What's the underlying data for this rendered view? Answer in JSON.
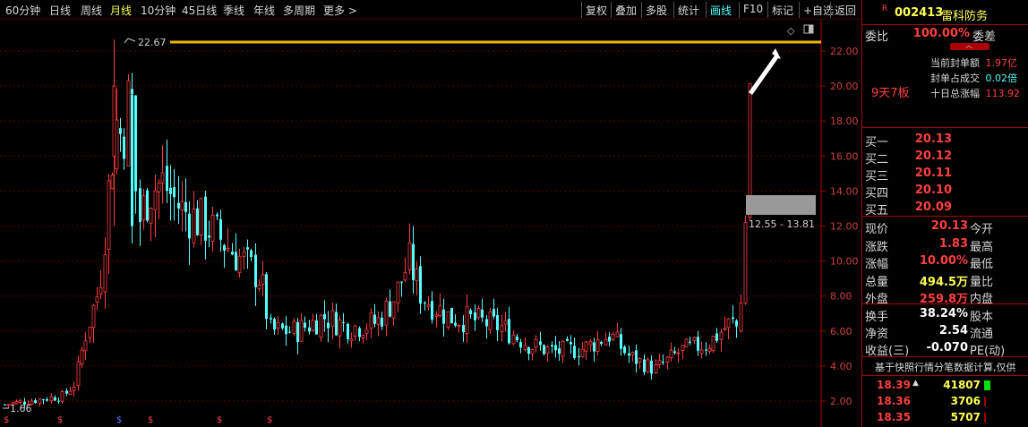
{
  "toolbar": {
    "periods": [
      "60分钟",
      "日线",
      "周线",
      "月线",
      "10分钟",
      "45日线",
      "季线",
      "年线",
      "多周期",
      "更多"
    ],
    "active_period": "月线",
    "more_arrow": ">",
    "buttons": [
      "复权",
      "叠加",
      "多股",
      "统计",
      "画线",
      "F10",
      "标记",
      "+自选",
      "返回"
    ],
    "active_button": "画线"
  },
  "chart": {
    "high_label": "22.67",
    "low_label": "1.66",
    "range_label": "12.55 - 13.81",
    "y_ticks": [
      "22.00",
      "20.00",
      "18.00",
      "16.00",
      "14.00",
      "12.00",
      "10.00",
      "8.00",
      "6.00",
      "4.00",
      "2.00"
    ],
    "colors": {
      "up": "#ff3c3c",
      "down": "#54ffff",
      "grid": "#5a0000",
      "hline": "#f0b400",
      "axis_text": "#d04040"
    },
    "markers": [
      "$",
      "$",
      "$",
      "$",
      "$",
      "$"
    ]
  },
  "panel": {
    "r_mark": "R",
    "code": "002413",
    "name": "雷科防务",
    "weibi_label": "委比",
    "weibi_value": "100.00%",
    "weicha_label": "委差",
    "seal_amount_label": "当前封单额",
    "seal_amount_value": "1.97亿",
    "seal_ratio_label": "封单占成交",
    "seal_ratio_value": "0.02倍",
    "ten_day_label": "十日总涨幅",
    "ten_day_value": "113.92",
    "streak": "9天7板",
    "bids": [
      {
        "label": "买一",
        "price": "20.13"
      },
      {
        "label": "买二",
        "price": "20.12"
      },
      {
        "label": "买三",
        "price": "20.11"
      },
      {
        "label": "买四",
        "price": "20.10"
      },
      {
        "label": "买五",
        "price": "20.09"
      }
    ],
    "quotes": [
      {
        "label": "现价",
        "value": "20.13",
        "label2": "今开",
        "color": "#ff4040"
      },
      {
        "label": "涨跌",
        "value": "1.83",
        "label2": "最高",
        "color": "#ff4040"
      },
      {
        "label": "涨幅",
        "value": "10.00%",
        "label2": "最低",
        "color": "#ff4040"
      },
      {
        "label": "总量",
        "value": "494.5万",
        "label2": "量比",
        "color": "#ffff55"
      },
      {
        "label": "外盘",
        "value": "259.8万",
        "label2": "内盘",
        "color": "#ff4040"
      }
    ],
    "stats": [
      {
        "label": "换手",
        "value": "38.24%",
        "label2": "股本",
        "color": "#ffffff"
      },
      {
        "label": "净资",
        "value": "2.54",
        "label2": "流通",
        "color": "#ffffff"
      },
      {
        "label": "收益(三)",
        "value": "-0.070",
        "label2": "PE(动)",
        "color": "#ffffff"
      }
    ],
    "tick_note": "基于快照行情分笔数据计算,仅供",
    "ticks": [
      {
        "price": "18.39",
        "arrow": "▲",
        "vol": "41807",
        "bar": 1.0
      },
      {
        "price": "18.36",
        "arrow": "",
        "vol": "3706",
        "bar": 0.25
      },
      {
        "price": "18.35",
        "arrow": "",
        "vol": "5707",
        "bar": 0.3
      }
    ]
  }
}
